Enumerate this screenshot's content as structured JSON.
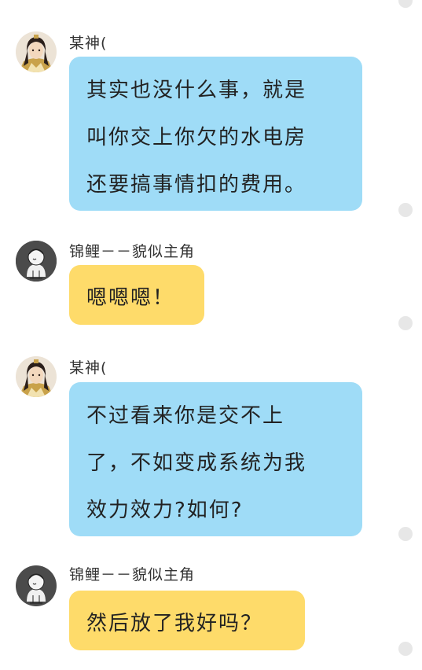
{
  "messages": [
    {
      "sender": "某神(",
      "avatar": "warrior-avatar-icon",
      "bubble_color": "#9fdcf7",
      "lines": [
        "其实也没什么事，就是",
        "叫你交上你欠的水电房",
        "还要搞事情扣的费用。"
      ]
    },
    {
      "sender": "锦鲤－－貌似主角",
      "avatar": "sketch-avatar-icon",
      "bubble_color": "#fedb6a",
      "lines": [
        "嗯嗯嗯！"
      ]
    },
    {
      "sender": "某神(",
      "avatar": "warrior-avatar-icon",
      "bubble_color": "#9fdcf7",
      "lines": [
        "不过看来你是交不上",
        "了，不如变成系统为我",
        "效力效力?如何?"
      ]
    },
    {
      "sender": "锦鲤－－貌似主角",
      "avatar": "sketch-avatar-icon",
      "bubble_color": "#fedb6a",
      "lines": [
        "然后放了我好吗？"
      ]
    }
  ]
}
